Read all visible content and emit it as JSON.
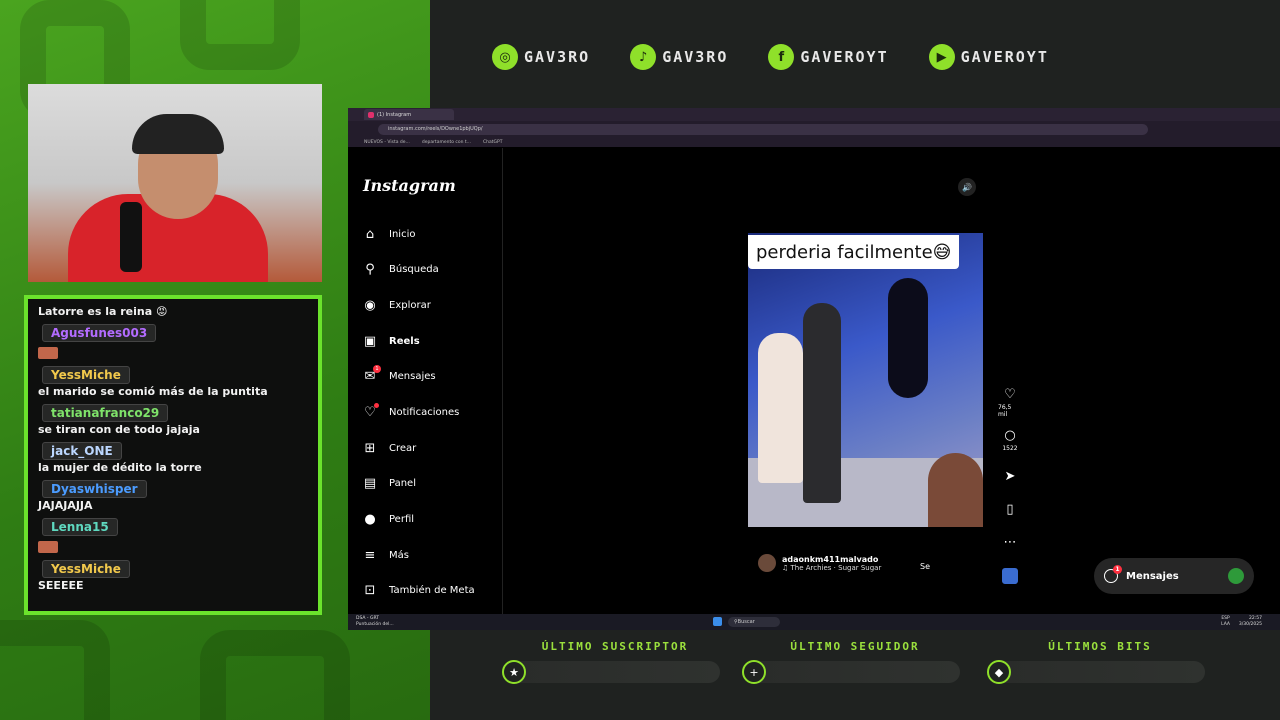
{
  "socials": [
    {
      "icon": "instagram-icon",
      "glyph": "◎",
      "handle": "GAV3RO"
    },
    {
      "icon": "tiktok-icon",
      "glyph": "♪",
      "handle": "GAV3RO"
    },
    {
      "icon": "facebook-icon",
      "glyph": "f",
      "handle": "GAVEROYT"
    },
    {
      "icon": "youtube-icon",
      "glyph": "▶",
      "handle": "GAVEROYT"
    }
  ],
  "chat": {
    "messages": [
      {
        "user": "",
        "text": "Latorre es la reina 😡"
      },
      {
        "user": "Agusfunes003",
        "user_color": "#b36cff",
        "text": ""
      },
      {
        "user": "YessMiche",
        "user_color": "#f2c94c",
        "text": "el marido se comió más de la puntita"
      },
      {
        "user": "tatianafranco29",
        "user_color": "#7fe36a",
        "text": "se tiran con de todo jajaja"
      },
      {
        "user": "jack_ONE",
        "user_color": "#bcd7ff",
        "text": "la mujer de dédito la torre"
      },
      {
        "user": "Dyaswhisper",
        "user_color": "#4b9cff",
        "text": "JAJAJAJJA"
      },
      {
        "user": "Lenna15",
        "user_color": "#5fd9c0",
        "text": ""
      },
      {
        "user": "YessMiche",
        "user_color": "#f2c94c",
        "text": "SEEEEE"
      }
    ]
  },
  "browser": {
    "tab_title": "(1) Instagram",
    "url": "instagram.com/reels/DOwne1pbjUQp/",
    "bookmarks": [
      "NUEVOS - Vista de...",
      "departamento con t...",
      "ChatGPT"
    ]
  },
  "instagram": {
    "logo": "Instagram",
    "nav": [
      {
        "label": "Inicio",
        "icon": "⌂",
        "name": "home-icon"
      },
      {
        "label": "Búsqueda",
        "icon": "⚲",
        "name": "search-icon"
      },
      {
        "label": "Explorar",
        "icon": "◉",
        "name": "explore-icon"
      },
      {
        "label": "Reels",
        "icon": "▣",
        "name": "reels-icon"
      },
      {
        "label": "Mensajes",
        "icon": "✉",
        "name": "messages-icon"
      },
      {
        "label": "Notificaciones",
        "icon": "♡",
        "name": "heart-icon"
      },
      {
        "label": "Crear",
        "icon": "⊞",
        "name": "create-icon"
      },
      {
        "label": "Panel",
        "icon": "▤",
        "name": "panel-icon"
      },
      {
        "label": "Perfil",
        "icon": "●",
        "name": "profile-icon"
      },
      {
        "label": "Más",
        "icon": "≡",
        "name": "menu-icon"
      },
      {
        "label": "También de Meta",
        "icon": "⊡",
        "name": "meta-icon"
      }
    ],
    "messages_badge": "1",
    "reel": {
      "caption": "perderia facilmente😅",
      "likes": "76,5 mil",
      "comments": "1522",
      "author": "adaonkm411malvado",
      "song": "The Archies · Sugar Sugar",
      "follow": "Se"
    },
    "messages_pill": {
      "label": "Mensajes",
      "badge": "1"
    }
  },
  "taskbar": {
    "weather_name": "DSA - GRT",
    "weather_sub": "Puntuación del...",
    "search": "Buscar",
    "lang": "ESP",
    "lang2": "LAA",
    "time": "22:57",
    "date": "3/30/2025"
  },
  "stats": [
    {
      "title": "ÚLTIMO SUSCRIPTOR",
      "icon": "★",
      "name": "star-icon"
    },
    {
      "title": "ÚLTIMO SEGUIDOR",
      "icon": "+",
      "name": "plus-icon"
    },
    {
      "title": "ÚLTIMOS BITS",
      "icon": "◆",
      "name": "bits-icon"
    }
  ]
}
